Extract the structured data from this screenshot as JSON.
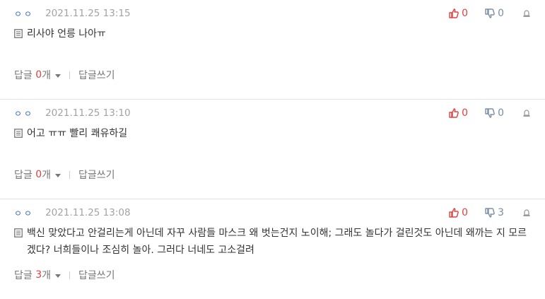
{
  "comments": [
    {
      "nick": "ㅇㅇ",
      "date": "2021.11.25 13:15",
      "likes": "0",
      "dislikes": "0",
      "text": "리사야 언릉 나아ㅠ",
      "reply_label": "답글",
      "reply_count": "0",
      "reply_unit": "개",
      "write_label": "답글쓰기"
    },
    {
      "nick": "ㅇㅇ",
      "date": "2021.11.25 13:10",
      "likes": "0",
      "dislikes": "0",
      "text": "어고 ㅠㅠ 빨리 쾌유하길",
      "reply_label": "답글",
      "reply_count": "0",
      "reply_unit": "개",
      "write_label": "답글쓰기"
    },
    {
      "nick": "ㅇㅇ",
      "date": "2021.11.25 13:08",
      "likes": "0",
      "dislikes": "3",
      "text": "백신 맞았다고 안걸리는게 아닌데 자꾸 사람들 마스크 왜 벗는건지 노이해; 그래도 놀다가 걸린것도 아닌데 왜까는 지 모르겠다? 너희들이나 조심히 놀아. 그러다 너네도 고소걸려",
      "reply_label": "답글",
      "reply_count": "3",
      "reply_unit": "개",
      "write_label": "답글쓰기"
    }
  ],
  "colors": {
    "accent_red": "#e04040",
    "nick_blue": "#3d6bc4",
    "muted": "#a3a3a3"
  },
  "icons": {
    "like": "thumbs-up-icon",
    "dislike": "thumbs-down-icon",
    "report": "siren-icon",
    "doc": "document-icon"
  }
}
